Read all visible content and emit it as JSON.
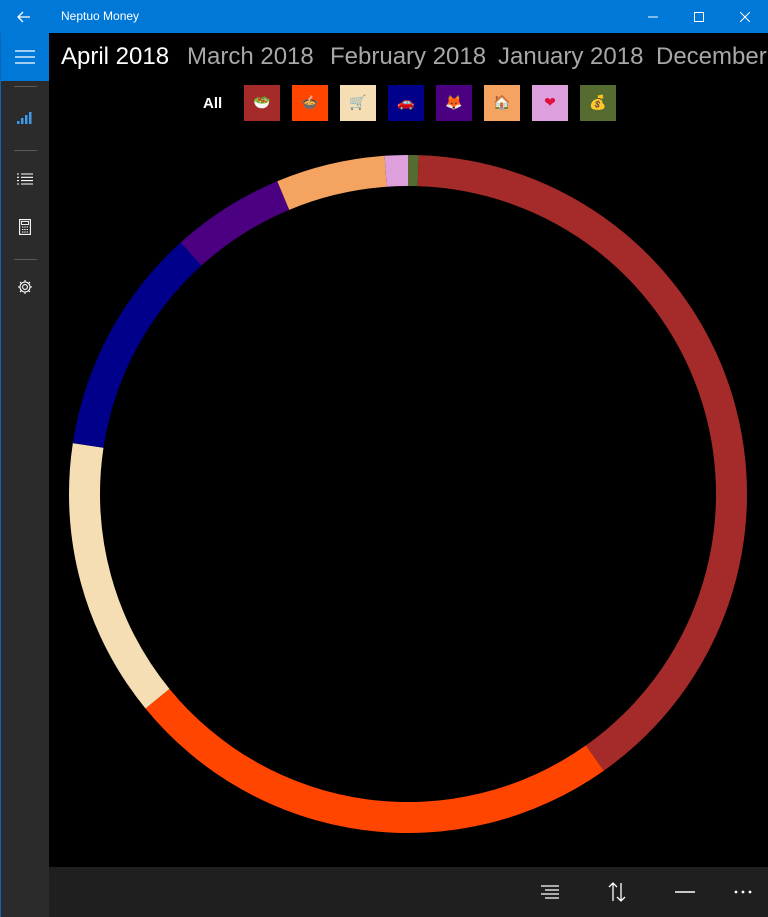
{
  "titlebar": {
    "title": "Neptuo Money",
    "back_icon": "back-arrow-icon",
    "minimize_icon": "minimize-icon",
    "maximize_icon": "maximize-icon",
    "close_icon": "close-icon"
  },
  "sidebar": {
    "menu_icon": "hamburger-menu-icon",
    "items": [
      {
        "name": "overview",
        "icon": "bar-chart-icon",
        "active": true
      },
      {
        "name": "list",
        "icon": "list-icon",
        "active": false
      },
      {
        "name": "calculator",
        "icon": "calculator-icon",
        "active": false
      },
      {
        "name": "settings",
        "icon": "gear-icon",
        "active": false
      }
    ]
  },
  "months": [
    {
      "label": "April 2018",
      "active": true
    },
    {
      "label": "March 2018",
      "active": false
    },
    {
      "label": "February 2018",
      "active": false
    },
    {
      "label": "January 2018",
      "active": false
    },
    {
      "label": "December",
      "active": false
    }
  ],
  "categories": {
    "all_label": "All",
    "items": [
      {
        "icon": "salad-bowl-icon",
        "glyph": "🥗",
        "color": "#a52a2a"
      },
      {
        "icon": "hot-pot-icon",
        "glyph": "🍲",
        "color": "#ff4500"
      },
      {
        "icon": "shopping-cart-icon",
        "glyph": "🛒",
        "color": "#f5deb3"
      },
      {
        "icon": "car-icon",
        "glyph": "🚗",
        "color": "#00008b"
      },
      {
        "icon": "fox-icon",
        "glyph": "🦊",
        "color": "#4b0082"
      },
      {
        "icon": "house-icon",
        "glyph": "🏠",
        "color": "#f4a460"
      },
      {
        "icon": "heart-icon",
        "glyph": "❤",
        "color": "#dda0dd"
      },
      {
        "icon": "money-bag-icon",
        "glyph": "💰",
        "color": "#556b2f"
      }
    ]
  },
  "chart_data": {
    "type": "pie",
    "donut": true,
    "start": "top",
    "direction": "clockwise",
    "slices": [
      {
        "share": 0.005,
        "color": "#556b2f"
      },
      {
        "share": 0.397,
        "color": "#a52a2a"
      },
      {
        "share": 0.239,
        "color": "#ff4500"
      },
      {
        "share": 0.133,
        "color": "#f5deb3"
      },
      {
        "share": 0.109,
        "color": "#00008b"
      },
      {
        "share": 0.054,
        "color": "#4b0082"
      },
      {
        "share": 0.052,
        "color": "#f4a460"
      },
      {
        "share": 0.011,
        "color": "#dda0dd"
      }
    ]
  },
  "bottombar": {
    "buttons": [
      {
        "name": "sort",
        "icon": "sort-lines-icon"
      },
      {
        "name": "swap",
        "icon": "swap-arrows-icon"
      },
      {
        "name": "remove",
        "icon": "minus-icon"
      },
      {
        "name": "more",
        "icon": "more-ellipsis-icon"
      }
    ]
  }
}
